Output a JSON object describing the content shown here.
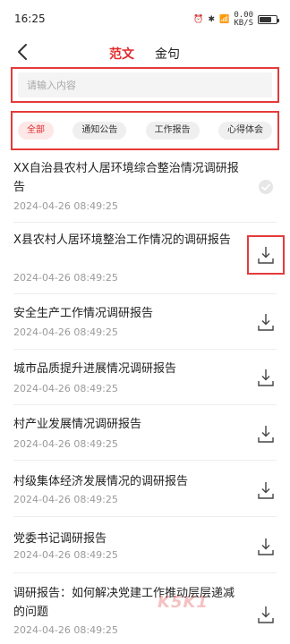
{
  "status_bar": {
    "time": "16:25",
    "net_speed_line1": "0.00",
    "net_speed_line2": "KB/S",
    "battery_level": 0.7
  },
  "nav": {
    "tab_active": "范文",
    "tab_inactive": "金句"
  },
  "search": {
    "placeholder": "请输入内容"
  },
  "filters": [
    {
      "label": "全部",
      "active": true
    },
    {
      "label": "通知公告",
      "active": false
    },
    {
      "label": "工作报告",
      "active": false
    },
    {
      "label": "心得体会",
      "active": false
    }
  ],
  "items": [
    {
      "title": "XX自治县农村人居环境综合整治情况调研报告",
      "date": "2024-04-26 08:49:25",
      "status": "downloaded"
    },
    {
      "title": "X县农村人居环境整治工作情况的调研报告",
      "date": "2024-04-26 08:49:25",
      "status": "download"
    },
    {
      "title": "安全生产工作情况调研报告",
      "date": "2024-04-26 08:49:25",
      "status": "download"
    },
    {
      "title": "城市品质提升进展情况调研报告",
      "date": "2024-04-26 08:49:25",
      "status": "download"
    },
    {
      "title": "村产业发展情况调研报告",
      "date": "2024-04-26 08:49:25",
      "status": "download"
    },
    {
      "title": "村级集体经济发展情况的调研报告",
      "date": "2024-04-26 08:49:25",
      "status": "download"
    },
    {
      "title": "党委书记调研报告",
      "date": "2024-04-26 08:49:25",
      "status": "download"
    },
    {
      "title": "调研报告：如何解决党建工作推动层层递减的问题",
      "date": "2024-04-26 08:49:25",
      "status": "download"
    }
  ],
  "watermark": "K5K1"
}
